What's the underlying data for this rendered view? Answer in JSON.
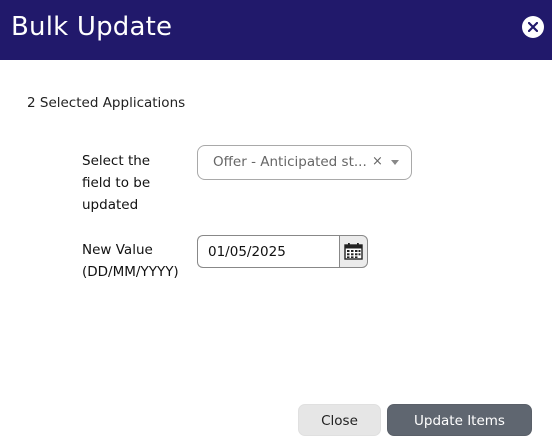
{
  "dialog": {
    "title": "Bulk Update"
  },
  "selected_count_text": "2 Selected Applications",
  "field_select": {
    "label": "Select the field to be updated",
    "value": "Offer - Anticipated st...",
    "clear_glyph": "×"
  },
  "new_value": {
    "label": "New Value (DD/MM/YYYY)",
    "value": "01/05/2025"
  },
  "buttons": {
    "close_label": "Close",
    "update_label": "Update Items"
  },
  "colors": {
    "header_bg": "#21196b",
    "update_button_bg": "#5f6670",
    "close_button_bg": "#e6e6e6"
  },
  "icons": {
    "dialog_close": "close-circle-icon",
    "select_clear": "clear-icon",
    "select_dropdown": "chevron-down-icon",
    "date_picker": "calendar-icon"
  }
}
